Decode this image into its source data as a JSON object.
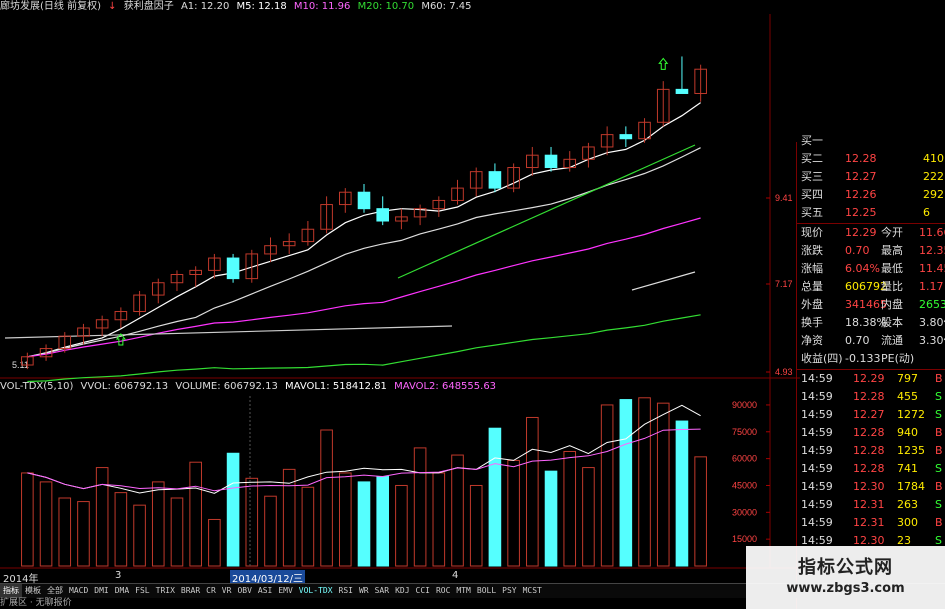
{
  "colors": {
    "up": "#c0392b",
    "down": "#55ffff",
    "ma5": "#ffffff",
    "ma10": "#ffeb00",
    "ma20": "#ff33ff",
    "ma60": "#33dd33",
    "price_green": "#33ff33",
    "price_red": "#ff4444",
    "label_white": "#dddddd"
  },
  "header": {
    "stock": "廊坊发展(日线 前复权)",
    "indicator": "获利盘因子",
    "a1": "A1: 12.20",
    "m5": "M5: 12.18",
    "m10": "M10: 11.96",
    "m20": "M20: 10.70",
    "m60": "M60: 7.45"
  },
  "vol_header": {
    "name": "VOL-TDX(5,10)",
    "vvol": "VVOL: 606792.13",
    "volume": "VOLUME: 606792.13",
    "mavol1": "MAVOL1: 518412.81",
    "mavol2": "MAVOL2: 648555.63"
  },
  "price_axis": [
    "9.41",
    "7.17",
    "4.93"
  ],
  "price_low_label": "5.11",
  "vol_axis": [
    "90000",
    "75000",
    "60000",
    "45000",
    "30000",
    "15000"
  ],
  "dates": {
    "left": "2014年",
    "mid1": "3",
    "cursor": "2014/03/12/三",
    "mid2": "4"
  },
  "chart_data": {
    "type": "candlestick",
    "title": "廊坊发展(日线 前复权)",
    "ohlc": [
      [
        5.1,
        5.4,
        5.0,
        5.3
      ],
      [
        5.3,
        5.6,
        5.2,
        5.5
      ],
      [
        5.5,
        5.9,
        5.4,
        5.8
      ],
      [
        5.8,
        6.1,
        5.6,
        6.0
      ],
      [
        6.0,
        6.3,
        5.8,
        6.2
      ],
      [
        6.2,
        6.5,
        6.0,
        6.4
      ],
      [
        6.4,
        6.9,
        6.3,
        6.8
      ],
      [
        6.8,
        7.2,
        6.6,
        7.1
      ],
      [
        7.1,
        7.4,
        6.9,
        7.3
      ],
      [
        7.3,
        7.5,
        7.0,
        7.4
      ],
      [
        7.4,
        7.8,
        7.2,
        7.7
      ],
      [
        7.7,
        7.8,
        7.1,
        7.2
      ],
      [
        7.2,
        7.9,
        7.1,
        7.8
      ],
      [
        7.8,
        8.2,
        7.6,
        8.0
      ],
      [
        8.0,
        8.3,
        7.8,
        8.1
      ],
      [
        8.1,
        8.6,
        8.0,
        8.4
      ],
      [
        8.4,
        9.2,
        8.3,
        9.0
      ],
      [
        9.0,
        9.4,
        8.8,
        9.3
      ],
      [
        9.3,
        9.5,
        8.8,
        8.9
      ],
      [
        8.9,
        9.2,
        8.5,
        8.6
      ],
      [
        8.6,
        8.9,
        8.4,
        8.7
      ],
      [
        8.7,
        9.0,
        8.5,
        8.9
      ],
      [
        8.9,
        9.2,
        8.7,
        9.1
      ],
      [
        9.1,
        9.6,
        9.0,
        9.4
      ],
      [
        9.4,
        9.9,
        9.2,
        9.8
      ],
      [
        9.8,
        10.0,
        9.3,
        9.4
      ],
      [
        9.4,
        10.0,
        9.3,
        9.9
      ],
      [
        9.9,
        10.4,
        9.7,
        10.2
      ],
      [
        10.2,
        10.4,
        9.8,
        9.9
      ],
      [
        9.9,
        10.3,
        9.8,
        10.1
      ],
      [
        10.1,
        10.5,
        9.9,
        10.4
      ],
      [
        10.4,
        10.9,
        10.2,
        10.7
      ],
      [
        10.7,
        10.9,
        10.4,
        10.6
      ],
      [
        10.6,
        11.1,
        10.5,
        11.0
      ],
      [
        11.0,
        12.0,
        10.9,
        11.8
      ],
      [
        11.8,
        12.6,
        11.7,
        11.7
      ],
      [
        11.7,
        12.4,
        11.5,
        12.29
      ]
    ],
    "volume": [
      52000,
      47000,
      38000,
      36000,
      55000,
      41000,
      34000,
      47000,
      38000,
      58000,
      26000,
      63000,
      49000,
      39000,
      54000,
      44000,
      76000,
      52000,
      47000,
      50000,
      45000,
      66000,
      52000,
      62000,
      45000,
      77000,
      59000,
      83000,
      53000,
      64000,
      55000,
      90000,
      93000,
      94000,
      91000,
      81000,
      61000
    ],
    "ylim": [
      4.93,
      13.0
    ],
    "vol_ylim": [
      0,
      95000
    ],
    "series": [
      {
        "name": "M5"
      },
      {
        "name": "M10"
      },
      {
        "name": "M20"
      },
      {
        "name": "M60"
      }
    ]
  },
  "quote": {
    "bid": [
      {
        "label": "买一",
        "price": "",
        "vol": ""
      },
      {
        "label": "买二",
        "price": "12.28",
        "vol": "410"
      },
      {
        "label": "买三",
        "price": "12.27",
        "vol": "222"
      },
      {
        "label": "买四",
        "price": "12.26",
        "vol": "292"
      },
      {
        "label": "买五",
        "price": "12.25",
        "vol": "6"
      }
    ],
    "stats": [
      {
        "l1": "现价",
        "v1": "12.29",
        "l2": "今开",
        "v2": "11.66",
        "c1": "#ff4444",
        "c2": "#ff4444"
      },
      {
        "l1": "涨跌",
        "v1": "0.70",
        "l2": "最高",
        "v2": "12.35",
        "c1": "#ff4444",
        "c2": "#ff4444"
      },
      {
        "l1": "涨幅",
        "v1": "6.04%",
        "l2": "最低",
        "v2": "11.45",
        "c1": "#ff4444",
        "c2": "#ff4444"
      },
      {
        "l1": "总量",
        "v1": "606792",
        "l2": "量比",
        "v2": "1.17",
        "c1": "#ffeb00",
        "c2": "#ff4444"
      },
      {
        "l1": "外盘",
        "v1": "341465",
        "l2": "内盘",
        "v2": "265327",
        "c1": "#ff4444",
        "c2": "#33ff33"
      },
      {
        "l1": "换手",
        "v1": "18.38%",
        "l2": "股本",
        "v2": "3.80亿",
        "c1": "#dddddd",
        "c2": "#dddddd"
      },
      {
        "l1": "净资",
        "v1": "0.70",
        "l2": "流通",
        "v2": "3.30亿",
        "c1": "#dddddd",
        "c2": "#dddddd"
      },
      {
        "l1": "收益(四)",
        "v1": "-0.133",
        "l2": "PE(动)",
        "v2": "",
        "c1": "#dddddd",
        "c2": "#dddddd"
      }
    ],
    "ticks": [
      {
        "t": "14:59",
        "p": "12.29",
        "v": "797",
        "s": "B"
      },
      {
        "t": "14:59",
        "p": "12.28",
        "v": "455",
        "s": "S"
      },
      {
        "t": "14:59",
        "p": "12.27",
        "v": "1272",
        "s": "S"
      },
      {
        "t": "14:59",
        "p": "12.28",
        "v": "940",
        "s": "B"
      },
      {
        "t": "14:59",
        "p": "12.28",
        "v": "1235",
        "s": "B"
      },
      {
        "t": "14:59",
        "p": "12.28",
        "v": "741",
        "s": "S"
      },
      {
        "t": "14:59",
        "p": "12.30",
        "v": "1784",
        "s": "B"
      },
      {
        "t": "14:59",
        "p": "12.31",
        "v": "263",
        "s": "S"
      },
      {
        "t": "14:59",
        "p": "12.31",
        "v": "300",
        "s": "B"
      },
      {
        "t": "14:59",
        "p": "12.30",
        "v": "23",
        "s": "S"
      }
    ]
  },
  "tabs": [
    "指标",
    "模板",
    "全部",
    "MACD",
    "DMI",
    "DMA",
    "FSL",
    "TRIX",
    "BRAR",
    "CR",
    "VR",
    "OBV",
    "ASI",
    "EMV",
    "VOL-TDX",
    "RSI",
    "WR",
    "SAR",
    "KDJ",
    "CCI",
    "ROC",
    "MTM",
    "BOLL",
    "PSY",
    "MCST"
  ],
  "status": "扩展区 · 无聊报价",
  "watermark": {
    "title": "指标公式网",
    "url": "www.zbgs3.com"
  }
}
